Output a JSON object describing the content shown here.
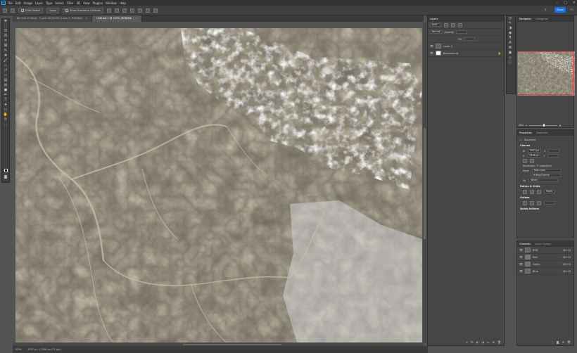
{
  "app": {
    "logo": "Ps"
  },
  "menu": [
    "File",
    "Edit",
    "Image",
    "Layer",
    "Type",
    "Select",
    "Filter",
    "3D",
    "View",
    "Plugins",
    "Window",
    "Help"
  ],
  "options": {
    "auto_select_label": "Auto-Select:",
    "auto_select_value": "Layer",
    "show_transform_label": "Show Transform Controls",
    "share_label": "Share"
  },
  "tabs": [
    {
      "label": "Bill Dell of Giant - 5 pele ikt 28.6% (Layer 1, RGB/8#)",
      "active": false
    },
    {
      "label": "Untitled-1 @ 100% (RGB/8#)",
      "active": true
    }
  ],
  "status": {
    "zoom": "100%",
    "doc": "3057 px x 2296 px (72 ppi)"
  },
  "layers": {
    "tabs": [
      "Layers"
    ],
    "search_label": "Kind",
    "blend_label": "Normal",
    "opacity_label": "Opacity",
    "fill_label": "Fill",
    "items": [
      {
        "name": "Layer 1"
      },
      {
        "name": "Background"
      }
    ]
  },
  "navigator": {
    "tabs": [
      "Navigator",
      "Histogram"
    ],
    "zoom": "28%"
  },
  "properties": {
    "tabs": [
      "Properties",
      "Swatches"
    ],
    "doc_label": "Document",
    "canvas_section": "Canvas",
    "w_label": "W",
    "w_value": "3057 px",
    "h_label": "H",
    "h_value": "2296 px",
    "x_label": "X",
    "y_label": "Y",
    "resolution": "Resolution: 72 pixels/inch",
    "mode_label": "Mode",
    "mode_value": "RGB Color",
    "depth_value": "8 Bits/Channel",
    "fill_label": "Fill",
    "fill_value": "White",
    "rulers_section": "Rulers & Grids",
    "rulers_unit": "Pixels",
    "guides_section": "Guides",
    "quick_section": "Quick Actions"
  },
  "channels": {
    "tabs": [
      "Channels",
      "Layer Comps"
    ],
    "items": [
      {
        "name": "RGB",
        "shortcut": "Ctrl+2"
      },
      {
        "name": "Red",
        "shortcut": "Ctrl+3"
      },
      {
        "name": "Green",
        "shortcut": "Ctrl+4"
      },
      {
        "name": "Blue",
        "shortcut": "Ctrl+5"
      }
    ]
  },
  "icons": [
    "move-icon",
    "marquee-icon",
    "lasso-icon",
    "wand-icon",
    "crop-icon",
    "eyedropper-icon",
    "heal-icon",
    "brush-icon",
    "stamp-icon",
    "history-brush-icon",
    "eraser-icon",
    "gradient-icon",
    "blur-icon",
    "dodge-icon",
    "pen-icon",
    "type-icon",
    "path-select-icon",
    "shape-icon",
    "hand-icon",
    "zoom-icon"
  ],
  "colors": {
    "accent": "#1473e6",
    "nav_frame": "#e0433b"
  }
}
